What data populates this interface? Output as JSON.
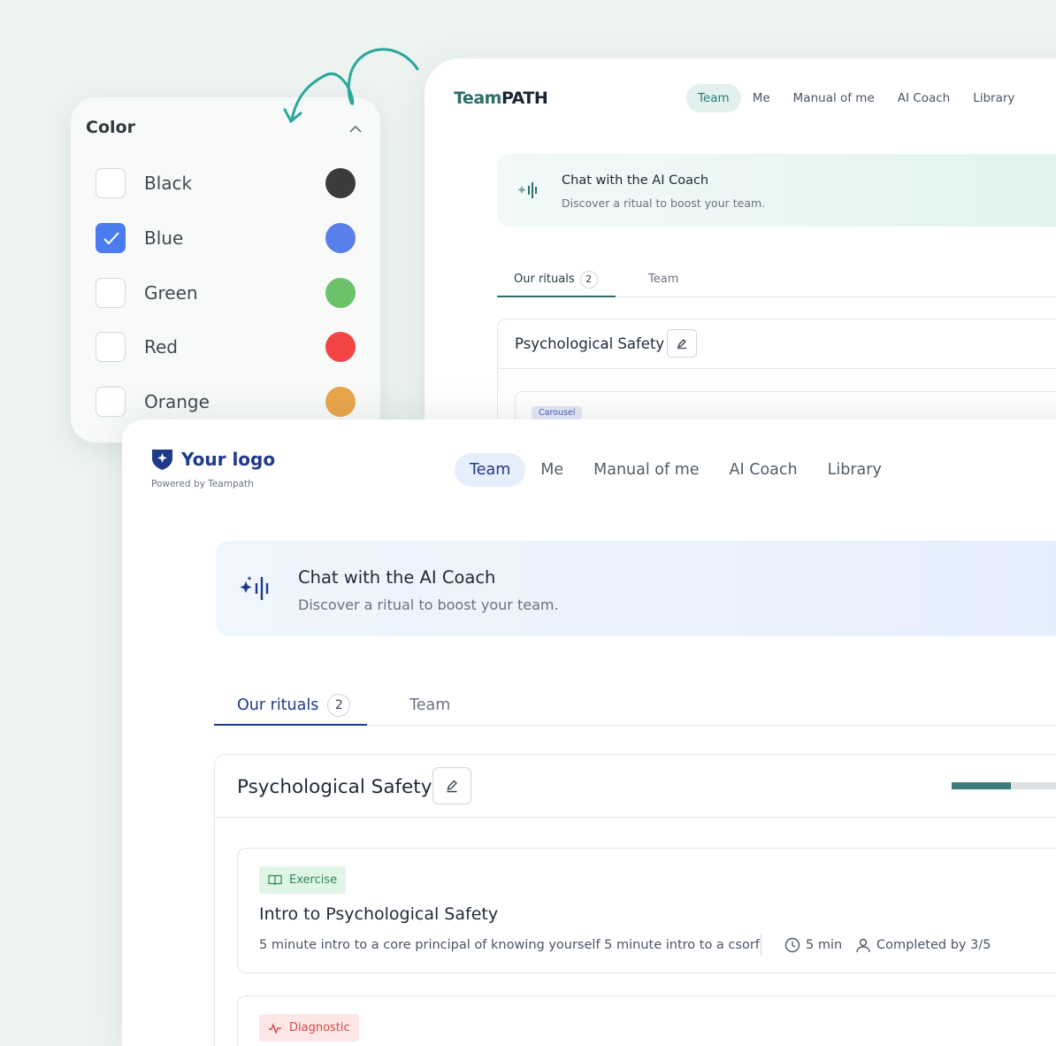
{
  "back_window": {
    "logo_teal": "Team",
    "logo_dark": "PATH",
    "nav": [
      "Team",
      "Me",
      "Manual of me",
      "AI Coach",
      "Library"
    ],
    "active_nav": "Team",
    "chat_title": "Chat with the AI Coach",
    "chat_subtitle": "Discover a ritual to boost your team.",
    "tabs": {
      "rituals_label": "Our rituals",
      "rituals_count": "2",
      "team_label": "Team"
    },
    "card_title": "Psychological Safety",
    "carousel_tag": "Carousel",
    "accent": "#2d6e6a"
  },
  "color_filter": {
    "heading": "Color",
    "options": [
      {
        "label": "Black",
        "color": "#3a3b3c",
        "checked": false
      },
      {
        "label": "Blue",
        "color": "#5b7fe8",
        "checked": true
      },
      {
        "label": "Green",
        "color": "#6bc26b",
        "checked": false
      },
      {
        "label": "Red",
        "color": "#f24444",
        "checked": false
      },
      {
        "label": "Orange",
        "color": "#eaa54a",
        "checked": false
      }
    ]
  },
  "front_window": {
    "brand_name": "Your logo",
    "powered_by": "Powered by Teampath",
    "nav": [
      "Team",
      "Me",
      "Manual of me",
      "AI Coach",
      "Library"
    ],
    "active_nav": "Team",
    "chat_title": "Chat with the AI Coach",
    "chat_subtitle": "Discover a ritual to boost your team.",
    "tabs": {
      "rituals_label": "Our rituals",
      "rituals_count": "2",
      "team_label": "Team"
    },
    "card": {
      "title": "Psychological Safety",
      "progress_fraction": 0.56,
      "rituals": [
        {
          "tag": "Exercise",
          "title": "Intro to Psychological Safety",
          "description": "5 minute intro to a core principal of knowing yourself 5 minute intro to a csorf",
          "duration": "5 min",
          "completed": "Completed by 3/5"
        },
        {
          "tag": "Diagnostic"
        }
      ]
    },
    "accent": "#1f3a8a"
  }
}
